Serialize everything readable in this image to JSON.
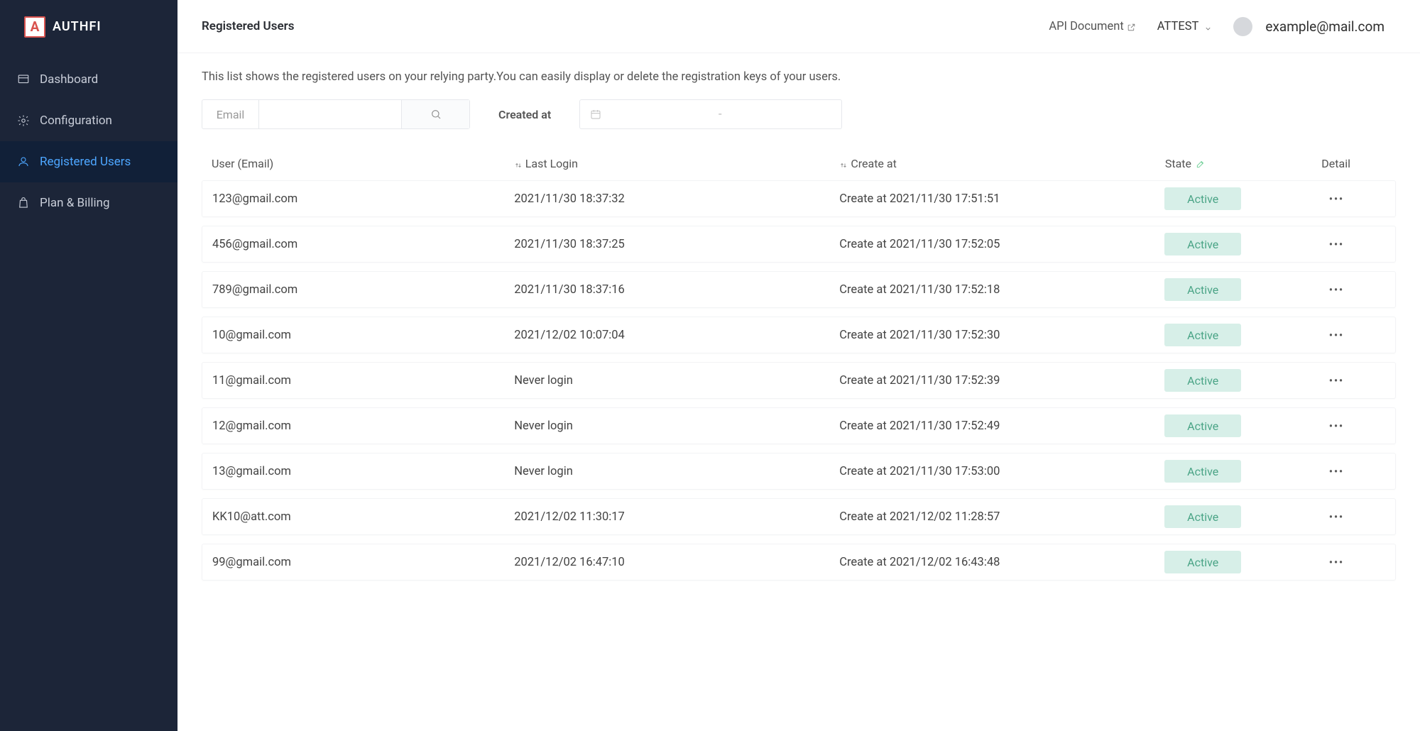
{
  "brand": {
    "icon_letter": "A",
    "name": "AUTHFI"
  },
  "sidebar": {
    "items": [
      {
        "label": "Dashboard",
        "icon": "dashboard-icon",
        "active": false
      },
      {
        "label": "Configuration",
        "icon": "gear-icon",
        "active": false
      },
      {
        "label": "Registered Users",
        "icon": "user-icon",
        "active": true
      },
      {
        "label": "Plan & Billing",
        "icon": "bag-icon",
        "active": false
      }
    ]
  },
  "header": {
    "title": "Registered Users",
    "api_link": "API Document",
    "org_dropdown": "ATTEST",
    "user_email": "example@mail.com"
  },
  "page": {
    "description": "This list shows the registered users on your relying party.You can easily display or delete the registration keys of your users.",
    "filters": {
      "email_label": "Email",
      "email_value": "",
      "created_label": "Created at",
      "date_separator": "-"
    },
    "table": {
      "columns": {
        "user": "User (Email)",
        "last_login": "Last Login",
        "created_at": "Create at",
        "state": "State",
        "detail": "Detail"
      },
      "rows": [
        {
          "email": "123@gmail.com",
          "last_login": "2021/11/30 18:37:32",
          "created": "Create at 2021/11/30 17:51:51",
          "state": "Active"
        },
        {
          "email": "456@gmail.com",
          "last_login": "2021/11/30 18:37:25",
          "created": "Create at 2021/11/30 17:52:05",
          "state": "Active"
        },
        {
          "email": "789@gmail.com",
          "last_login": "2021/11/30 18:37:16",
          "created": "Create at 2021/11/30 17:52:18",
          "state": "Active"
        },
        {
          "email": "10@gmail.com",
          "last_login": "2021/12/02 10:07:04",
          "created": "Create at 2021/11/30 17:52:30",
          "state": "Active"
        },
        {
          "email": "11@gmail.com",
          "last_login": "Never login",
          "created": "Create at 2021/11/30 17:52:39",
          "state": "Active"
        },
        {
          "email": "12@gmail.com",
          "last_login": "Never login",
          "created": "Create at 2021/11/30 17:52:49",
          "state": "Active"
        },
        {
          "email": "13@gmail.com",
          "last_login": "Never login",
          "created": "Create at 2021/11/30 17:53:00",
          "state": "Active"
        },
        {
          "email": "KK10@att.com",
          "last_login": "2021/12/02 11:30:17",
          "created": "Create at 2021/12/02 11:28:57",
          "state": "Active"
        },
        {
          "email": "99@gmail.com",
          "last_login": "2021/12/02 16:47:10",
          "created": "Create at 2021/12/02 16:43:48",
          "state": "Active"
        }
      ]
    }
  }
}
